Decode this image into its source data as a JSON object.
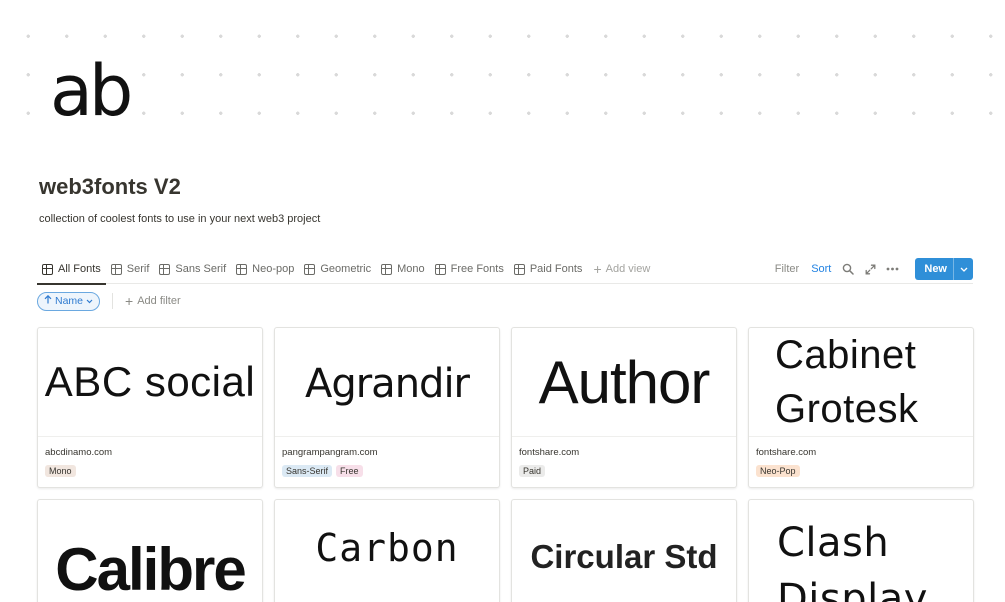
{
  "page": {
    "icon_text": "ab",
    "title": "web3fonts V2",
    "description": "collection of coolest fonts to use in your next web3 project"
  },
  "tabs": [
    {
      "label": "All Fonts",
      "active": true
    },
    {
      "label": "Serif"
    },
    {
      "label": "Sans Serif"
    },
    {
      "label": "Neo-pop"
    },
    {
      "label": "Geometric"
    },
    {
      "label": "Mono"
    },
    {
      "label": "Free Fonts"
    },
    {
      "label": "Paid Fonts"
    }
  ],
  "add_view_label": "Add view",
  "toolbar": {
    "filter_label": "Filter",
    "sort_label": "Sort",
    "search_icon": "search-icon",
    "expand_icon": "expand-icon",
    "more_icon": "more-icon",
    "new_label": "New"
  },
  "filters": {
    "sort_pill_label": "Name",
    "add_filter_label": "Add filter"
  },
  "colors": {
    "accent": "#2f8fd8",
    "sort_text": "#2383e2",
    "tag_mono": "#f1e6df",
    "tag_sans_serif": "#dbe9f4",
    "tag_free": "#f7dfe9",
    "tag_paid": "#ebebea",
    "tag_neo_pop": "#fbe2cf"
  },
  "cards": [
    {
      "preview": "ABC social",
      "url": "abcdinamo.com",
      "tags": [
        {
          "label": "Mono",
          "color": "#f1e6df"
        }
      ]
    },
    {
      "preview": "Agrandir",
      "url": "pangrampangram.com",
      "tags": [
        {
          "label": "Sans-Serif",
          "color": "#dbe9f4"
        },
        {
          "label": "Free",
          "color": "#f7dfe9"
        }
      ]
    },
    {
      "preview": "Author",
      "url": "fontshare.com",
      "tags": [
        {
          "label": "Paid",
          "color": "#ebebea"
        }
      ]
    },
    {
      "preview": "Cabinet\nGrotesk",
      "url": "fontshare.com",
      "tags": [
        {
          "label": "Neo-Pop",
          "color": "#fbe2cf"
        }
      ]
    },
    {
      "preview": "Calibre",
      "url": "",
      "tags": []
    },
    {
      "preview": "Carbon",
      "url": "",
      "tags": []
    },
    {
      "preview": "Circular Std",
      "url": "",
      "tags": []
    },
    {
      "preview": "Clash\nDisplay",
      "url": "",
      "tags": []
    }
  ]
}
